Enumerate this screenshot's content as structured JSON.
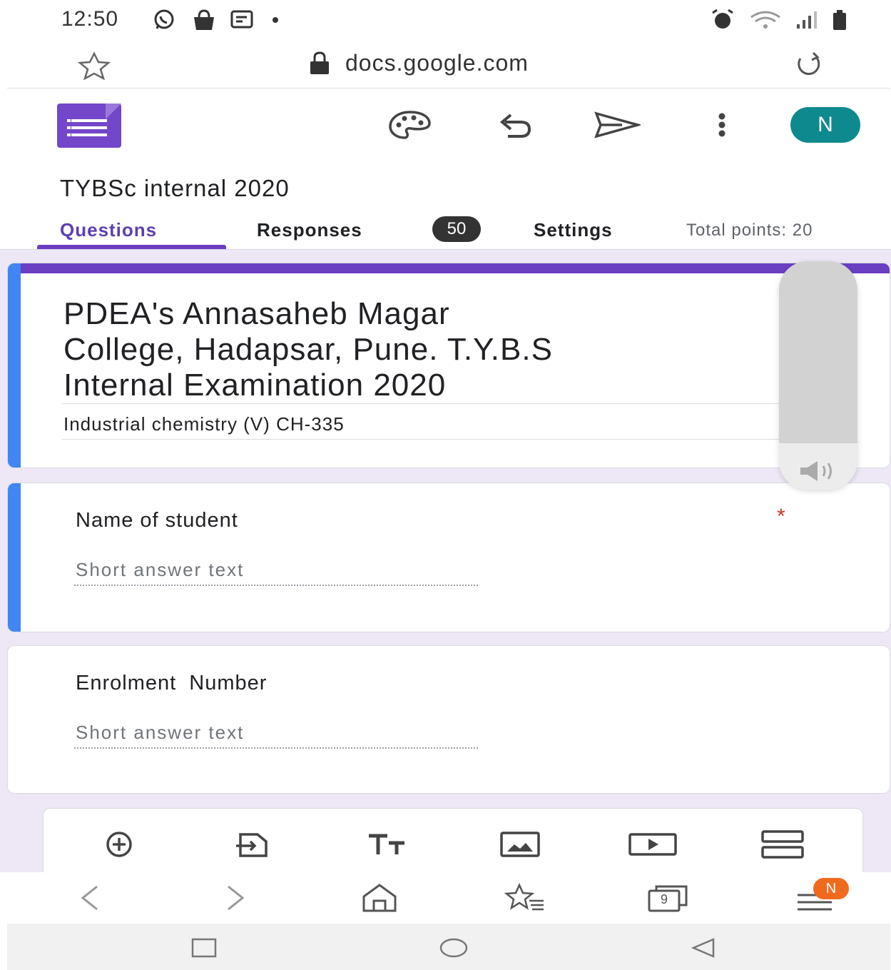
{
  "status_bar": {
    "time": "12:50",
    "left_icons": [
      "whatsapp-icon",
      "shopping-bag-icon",
      "message-icon",
      "dot-icon"
    ],
    "right_icons": [
      "alarm-icon",
      "wifi-icon",
      "signal-icon",
      "battery-icon"
    ]
  },
  "browser": {
    "url": "docs.google.com",
    "icons": [
      "star-icon",
      "lock-icon",
      "reload-icon"
    ]
  },
  "app_header": {
    "logo": "google-forms-logo",
    "actions": [
      "palette-icon",
      "undo-icon",
      "send-icon",
      "more-vert-icon"
    ],
    "avatar_letter": "N",
    "avatar_color": "#0e8a8f",
    "form_title": "TYBSc internal 2020"
  },
  "tabs": {
    "questions": "Questions",
    "responses": "Responses",
    "responses_count": "50",
    "settings": "Settings",
    "total_points": "Total points: 20",
    "accent_color": "#6a3fc2"
  },
  "form_header": {
    "title": "PDEA's Annasaheb Magar College, Hadapsar, Pune. T.Y.B.Sc Internal Examination 2020",
    "title_lines": [
      "PDEA's Annasaheb Magar",
      "College, Hadapsar, Pune. T.Y.B.S",
      "Internal Examination 2020"
    ],
    "description": "Industrial chemistry (V) CH-335"
  },
  "questions": [
    {
      "title": "Name of student",
      "placeholder": "Short answer text",
      "required": true,
      "required_mark": "*"
    },
    {
      "title": "Enrolment  Number",
      "placeholder": "Short answer text",
      "required": false
    }
  ],
  "volume_overlay": {
    "icon": "speaker-icon"
  },
  "form_toolbar": [
    "add-question-icon",
    "import-questions-icon",
    "add-title-icon",
    "add-image-icon",
    "add-video-icon",
    "add-section-icon"
  ],
  "browser_nav": {
    "icons": [
      "back-icon",
      "forward-icon",
      "home-icon",
      "bookmarks-icon",
      "tabs-icon",
      "menu-icon"
    ],
    "tabs_count": "9",
    "notification_letter": "N",
    "notification_color": "#f06a1d"
  },
  "system_nav": [
    "recents-icon",
    "home-circle-icon",
    "back-triangle-icon"
  ]
}
